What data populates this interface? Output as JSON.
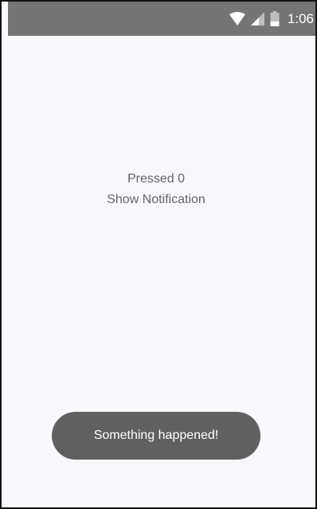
{
  "status_bar": {
    "time": "1:06",
    "icons": [
      "wifi-icon",
      "signal-icon",
      "battery-icon"
    ],
    "background": "#757575"
  },
  "main": {
    "pressed_text": "Pressed 0",
    "show_notification_label": "Show Notification"
  },
  "toast": {
    "message": "Something happened!",
    "background": "#606060"
  },
  "colors": {
    "screen_background": "#f8f9fd",
    "text": "#666666"
  }
}
